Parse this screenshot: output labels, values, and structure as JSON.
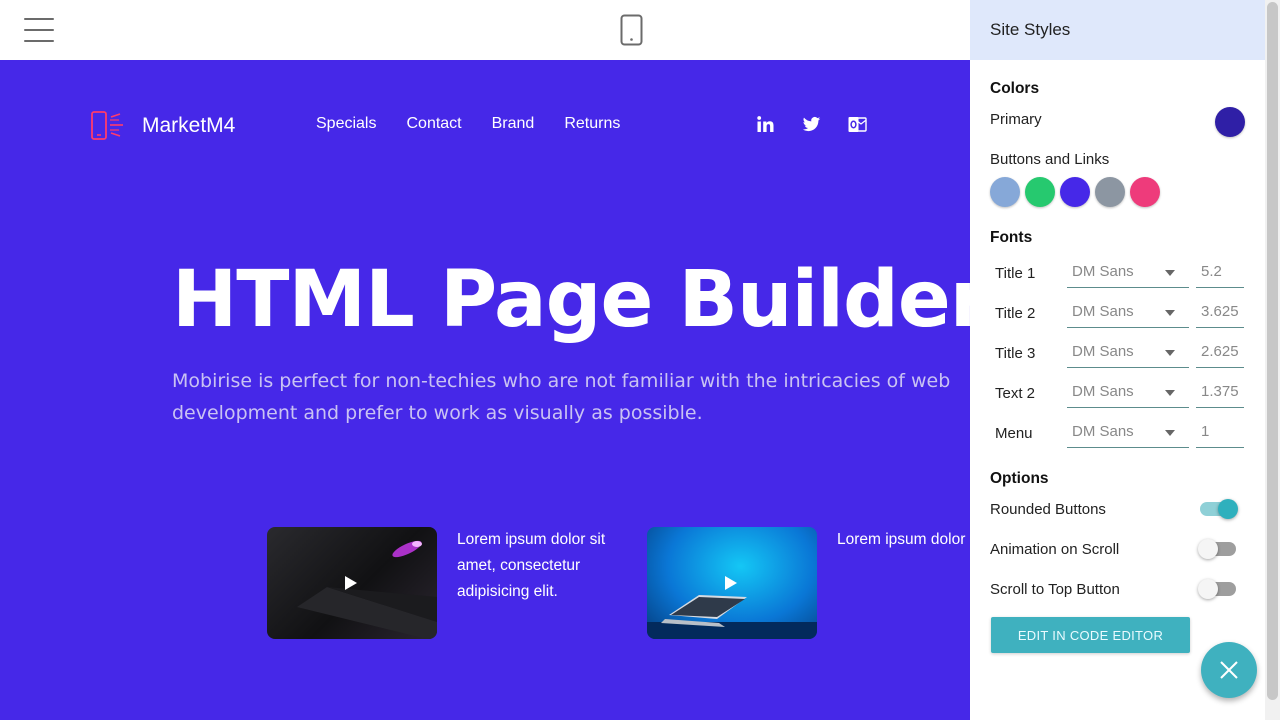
{
  "topbar": {
    "menu_icon": "hamburger-icon",
    "device_icon": "mobile-phone-icon"
  },
  "site": {
    "brand_name": "MarketM4",
    "brand_icon": "mobile-phone-logo-icon",
    "nav": [
      "Specials",
      "Contact",
      "Brand",
      "Returns"
    ],
    "socials": [
      "linkedin-icon",
      "twitter-icon",
      "outlook-icon"
    ],
    "hero_title": "HTML Page Builder",
    "hero_subtitle": "Mobirise is perfect for non-techies who are not familiar with the intricacies of web development and prefer to work as visually as possible.",
    "cards": [
      {
        "text": "Lorem ipsum dolor sit amet, consectetur adipisicing elit.",
        "thumb_icon": "play-icon"
      },
      {
        "text": "Lorem ipsum dolor sit amet, consectetur adipisicing elit.",
        "thumb_icon": "play-icon"
      }
    ],
    "background_color": "#4628e8"
  },
  "panel": {
    "title": "Site Styles",
    "colors": {
      "title": "Colors",
      "primary_label": "Primary",
      "primary_color": "#2f1fa6",
      "buttons_links_label": "Buttons and Links",
      "swatches": [
        "#86a8d8",
        "#26c96f",
        "#4628e8",
        "#8c96a2",
        "#ee3b7b"
      ]
    },
    "fonts": {
      "title": "Fonts",
      "rows": [
        {
          "label": "Title 1",
          "font": "DM Sans",
          "size": "5.2"
        },
        {
          "label": "Title 2",
          "font": "DM Sans",
          "size": "3.625"
        },
        {
          "label": "Title 3",
          "font": "DM Sans",
          "size": "2.625"
        },
        {
          "label": "Text 2",
          "font": "DM Sans",
          "size": "1.375"
        },
        {
          "label": "Menu",
          "font": "DM Sans",
          "size": "1"
        }
      ]
    },
    "options": {
      "title": "Options",
      "items": [
        {
          "label": "Rounded Buttons",
          "on": true
        },
        {
          "label": "Animation on Scroll",
          "on": false
        },
        {
          "label": "Scroll to Top Button",
          "on": false
        }
      ]
    },
    "code_button": "EDIT IN CODE EDITOR",
    "accent_color": "#3fb1bf"
  },
  "fab": {
    "icon": "close-icon"
  }
}
